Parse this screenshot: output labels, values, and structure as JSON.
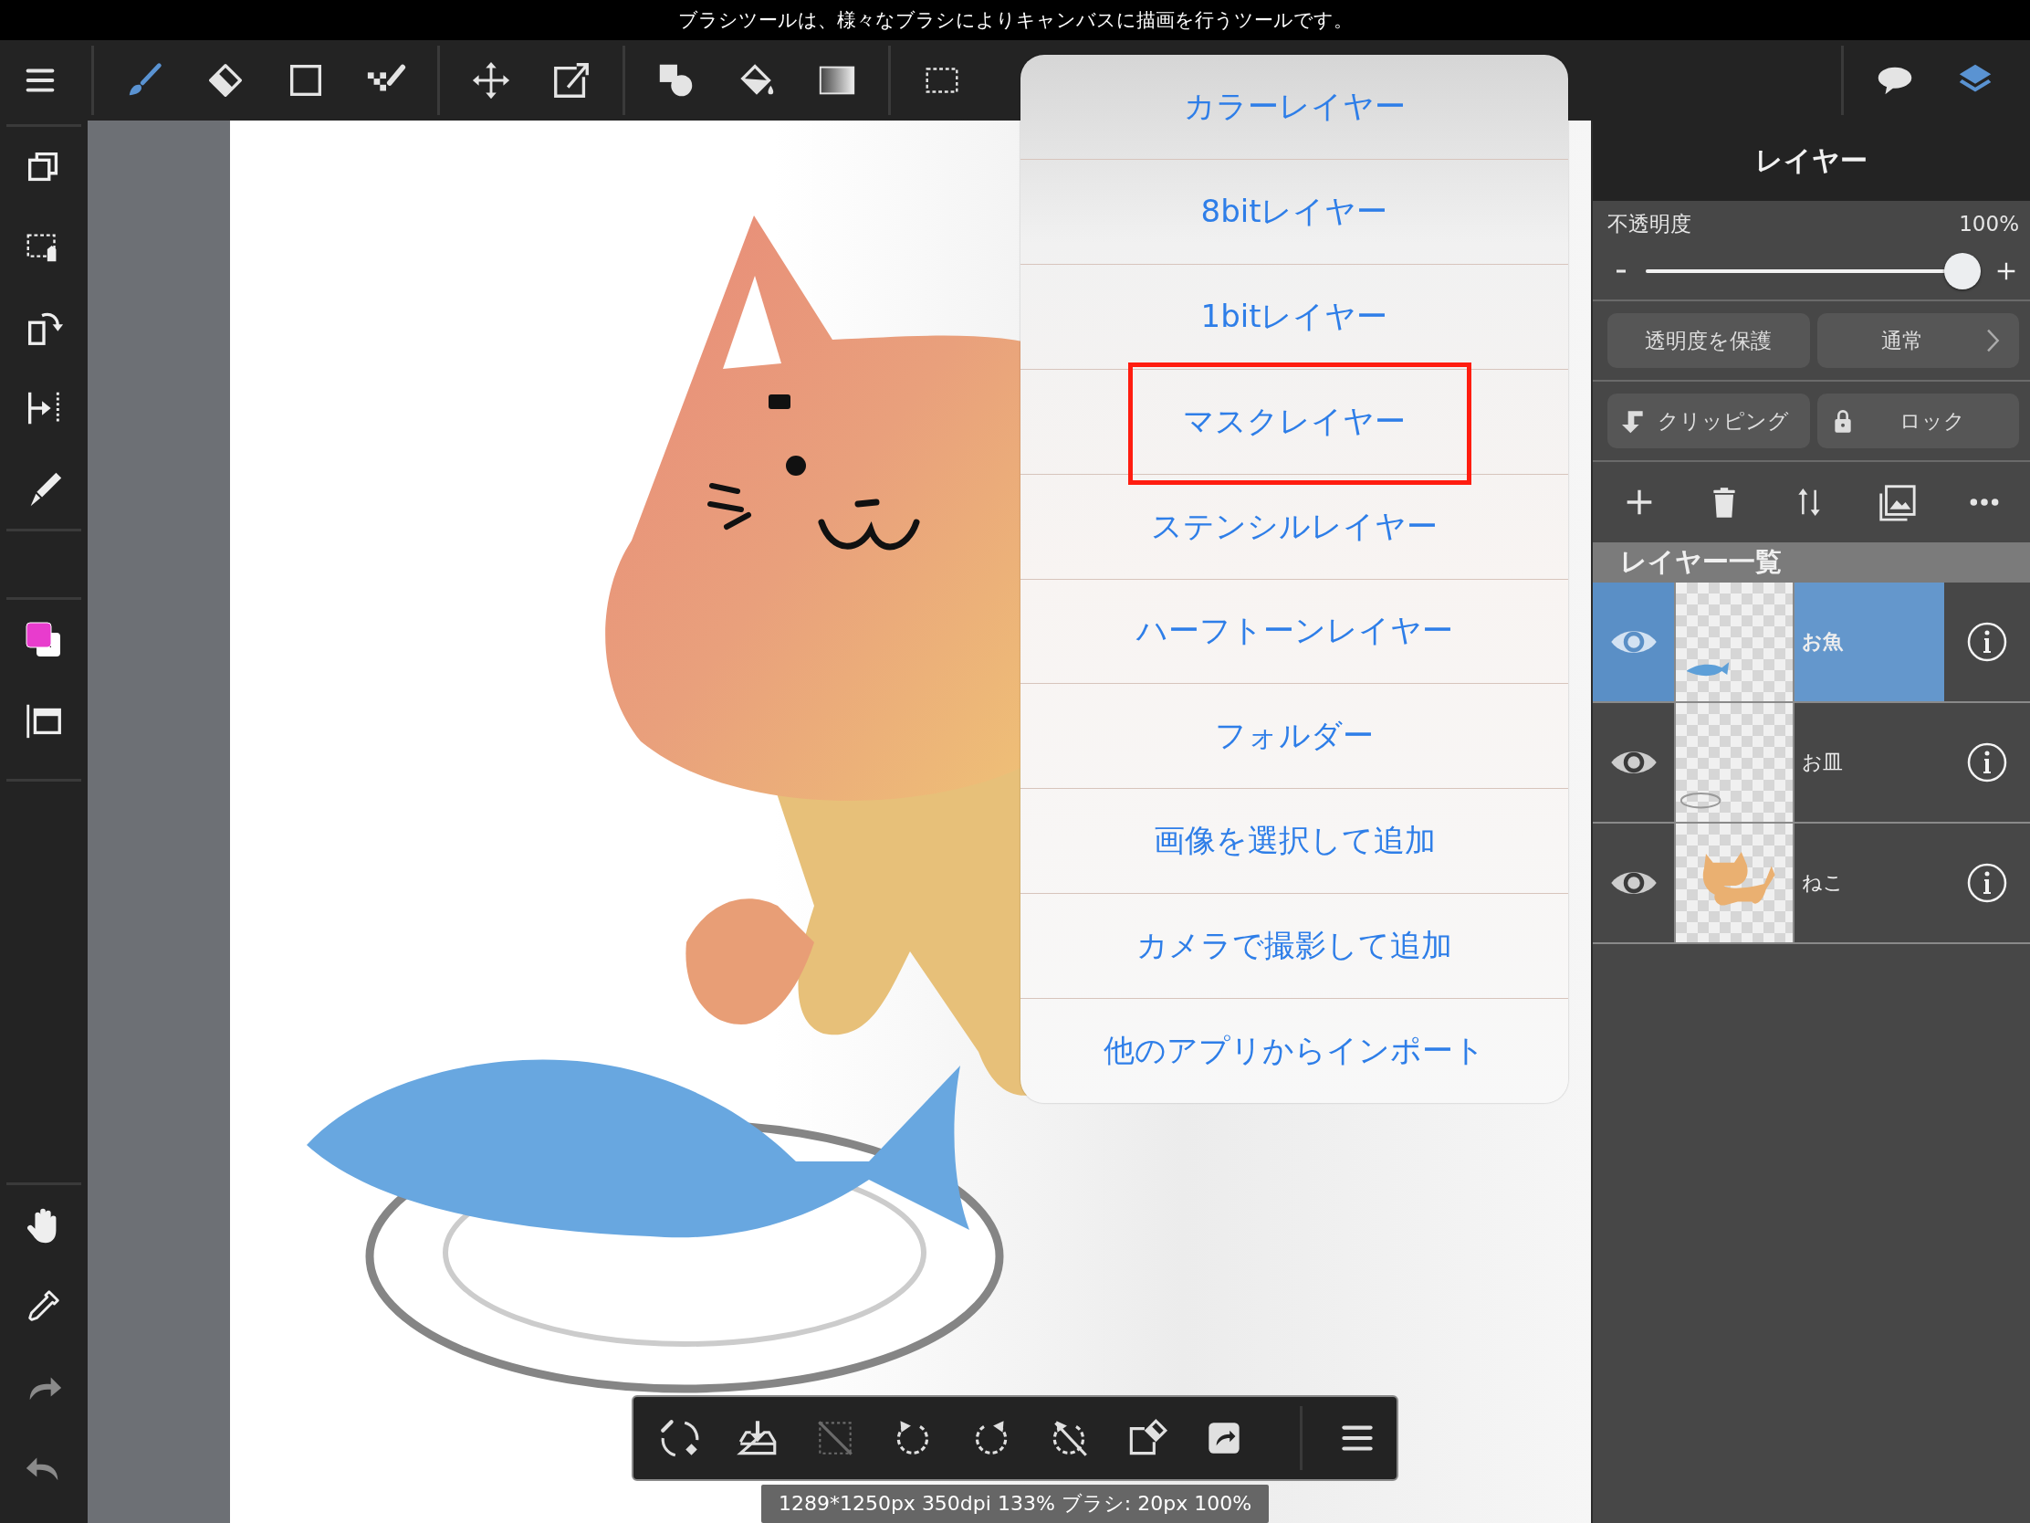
{
  "hint_bar": {
    "text": "ブラシツールは、様々なブラシによりキャンバスに描画を行うツールです。"
  },
  "top_toolbar": {
    "groups": [
      {
        "tools": [
          {
            "kind": "menu",
            "selected": false
          }
        ]
      },
      {
        "tools": [
          {
            "kind": "brush",
            "selected": true
          },
          {
            "kind": "eraser",
            "selected": false
          },
          {
            "kind": "rect",
            "selected": false
          },
          {
            "kind": "dotpen",
            "selected": false
          }
        ]
      },
      {
        "tools": [
          {
            "kind": "move",
            "selected": false
          },
          {
            "kind": "transform",
            "selected": false
          }
        ]
      },
      {
        "tools": [
          {
            "kind": "shape",
            "selected": false
          },
          {
            "kind": "bucket",
            "selected": false
          },
          {
            "kind": "gradient",
            "selected": false
          }
        ]
      },
      {
        "tools": [
          {
            "kind": "select",
            "selected": false
          }
        ]
      }
    ],
    "right_tools": [
      {
        "kind": "bubble",
        "selected": false
      },
      {
        "kind": "layers",
        "selected": true
      }
    ]
  },
  "sidebar": {
    "groups": [
      {
        "tools": [
          {
            "kind": "copy",
            "disabled": false
          },
          {
            "kind": "sellayer",
            "disabled": false
          },
          {
            "kind": "rotate",
            "disabled": false
          },
          {
            "kind": "flip",
            "disabled": false
          },
          {
            "kind": "pen",
            "disabled": false
          }
        ]
      },
      {
        "tools": [
          {
            "kind": "frame",
            "disabled": false
          }
        ]
      },
      {
        "tools": [
          {
            "kind": "hand",
            "disabled": false
          },
          {
            "kind": "dropper",
            "disabled": false
          },
          {
            "kind": "redo",
            "disabled": true
          },
          {
            "kind": "undo",
            "disabled": true
          }
        ]
      }
    ],
    "colors": [
      {
        "color": "#e83ccd"
      },
      {
        "color": "#ffffff"
      }
    ]
  },
  "add_layer_menu": {
    "items": [
      {
        "label": "カラーレイヤー",
        "highlighted": false
      },
      {
        "label": "8bitレイヤー",
        "highlighted": false
      },
      {
        "label": "1bitレイヤー",
        "highlighted": false
      },
      {
        "label": "マスクレイヤー",
        "highlighted": true
      },
      {
        "label": "ステンシルレイヤー",
        "highlighted": false
      },
      {
        "label": "ハーフトーンレイヤー",
        "highlighted": false
      },
      {
        "label": "フォルダー",
        "highlighted": false
      },
      {
        "label": "画像を選択して追加",
        "highlighted": false
      },
      {
        "label": "カメラで撮影して追加",
        "highlighted": false
      },
      {
        "label": "他のアプリからインポート",
        "highlighted": false
      }
    ]
  },
  "layer_panel": {
    "title": "レイヤー",
    "opacity": {
      "label": "不透明度",
      "value": "100%",
      "level": 1.0
    },
    "buttons": [
      {
        "kind": "toggle",
        "label": "透明度を保護"
      },
      {
        "kind": "blend",
        "label": "通常"
      },
      {
        "kind": "clipping",
        "label": "クリッピング"
      },
      {
        "kind": "lock",
        "label": "ロック"
      }
    ],
    "actions": [
      {
        "kind": "plus"
      },
      {
        "kind": "trash"
      },
      {
        "kind": "swap"
      },
      {
        "kind": "image"
      },
      {
        "kind": "more"
      }
    ],
    "list_title": "レイヤー一覧",
    "layers": [
      {
        "name": "お魚",
        "selected": true,
        "visible": true
      },
      {
        "name": "お皿",
        "selected": false,
        "visible": true
      },
      {
        "name": "ねこ",
        "selected": false,
        "visible": true
      }
    ]
  },
  "bottom_toolbar": {
    "tools": [
      {
        "kind": "toggle",
        "disabled": false
      },
      {
        "kind": "save",
        "disabled": false
      },
      {
        "kind": "deselect",
        "disabled": true
      },
      {
        "kind": "rotl",
        "disabled": false
      },
      {
        "kind": "rotr",
        "disabled": false
      },
      {
        "kind": "norotate",
        "disabled": false
      },
      {
        "kind": "erasersel",
        "disabled": false
      },
      {
        "kind": "share",
        "disabled": false
      },
      {
        "kind": "menu",
        "disabled": false
      }
    ]
  },
  "status_bar": {
    "text": "1289*1250px 350dpi 133% ブラシ: 20px 100%"
  }
}
